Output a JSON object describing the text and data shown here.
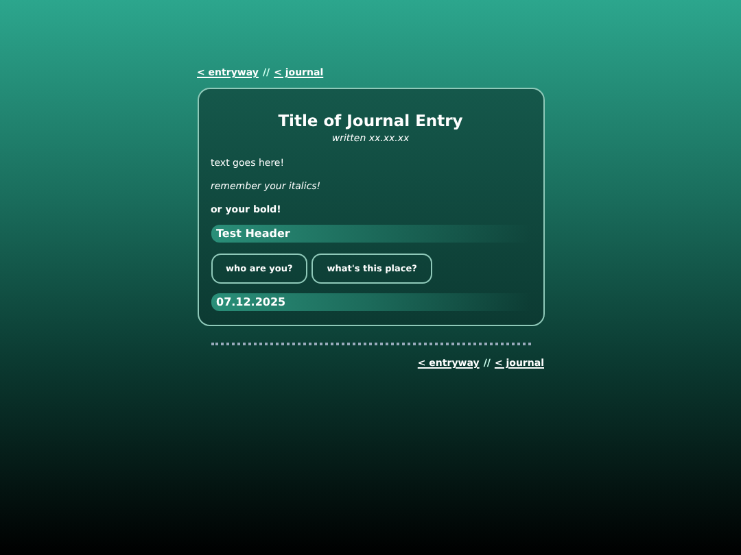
{
  "top_nav": {
    "links": [
      "< entryway",
      "< journal"
    ],
    "separator": "//"
  },
  "entry": {
    "title": "Title of Journal Entry",
    "subtitle": "written xx.xx.xx",
    "paragraphs": [
      {
        "text": "text goes here!",
        "kind": "plain"
      },
      {
        "text": "remember your italics!",
        "kind": "italic"
      },
      {
        "text": "or your bold!",
        "kind": "bold"
      }
    ],
    "header": "Test Header",
    "buttons": [
      "who are you?",
      "what's this place?"
    ],
    "date": "07.12.2025"
  },
  "bottom_nav": {
    "links": [
      "< entryway",
      "< journal"
    ],
    "separator": "//"
  }
}
